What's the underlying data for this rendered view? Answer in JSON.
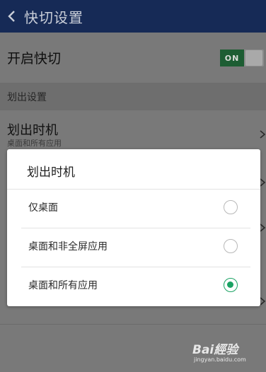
{
  "header": {
    "title": "快切设置"
  },
  "settings": {
    "toggle_label": "开启快切",
    "toggle_state": "ON",
    "section_title": "划出设置",
    "timing_title": "划出时机",
    "timing_value": "桌面和所有应用"
  },
  "dialog": {
    "title": "划出时机",
    "options": [
      {
        "label": "仅桌面",
        "selected": false
      },
      {
        "label": "桌面和非全屏应用",
        "selected": false
      },
      {
        "label": "桌面和所有应用",
        "selected": true
      }
    ],
    "accent_color": "#1aa263"
  },
  "watermark": {
    "brand": "Bai經验",
    "url": "jingyan.baidu.com"
  }
}
